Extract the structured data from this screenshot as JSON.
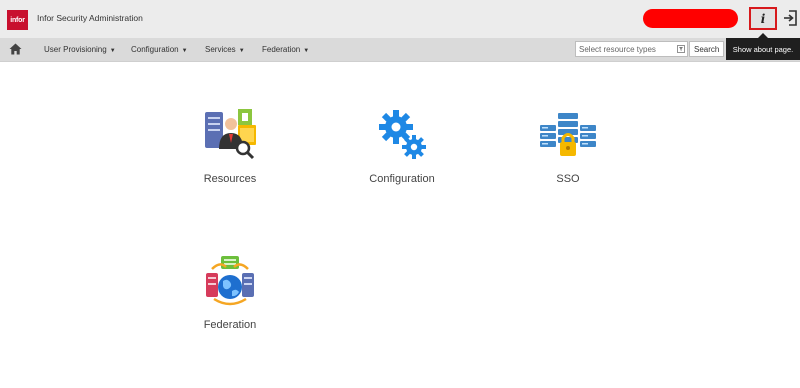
{
  "header": {
    "logo_text": "infor",
    "app_title": "Infor Security Administration",
    "info_icon_glyph": "i",
    "info_icon": "info-icon",
    "logout_icon": "sign-in-icon"
  },
  "nav": {
    "home_icon": "home-icon",
    "items": [
      {
        "label": "User Provisioning"
      },
      {
        "label": "Configuration"
      },
      {
        "label": "Services"
      },
      {
        "label": "Federation"
      }
    ],
    "search_placeholder": "Select resource types",
    "search_button": "Search"
  },
  "tooltip": {
    "text": "Show about page."
  },
  "tiles": [
    {
      "label": "Resources",
      "icon": "resources-icon"
    },
    {
      "label": "Configuration",
      "icon": "gears-icon"
    },
    {
      "label": "SSO",
      "icon": "sso-servers-lock-icon"
    },
    {
      "label": "Federation",
      "icon": "federation-globe-icon"
    }
  ],
  "colors": {
    "brand": "#c8102e",
    "highlight": "#d7191c",
    "redacted": "#ff0000"
  }
}
